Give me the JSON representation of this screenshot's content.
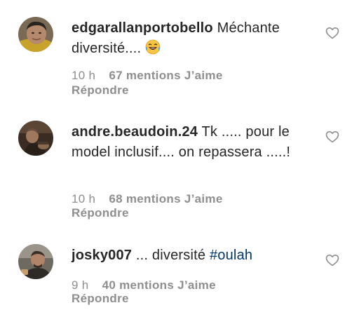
{
  "comments": [
    {
      "username": "edgarallanportobello",
      "text": "Méchante diversité....",
      "emoji": "laughing-crying-emoji",
      "time": "10 h",
      "likes": "67 mentions J’aime",
      "reply": "Répondre"
    },
    {
      "username": "andre.beaudoin.24",
      "text": "Tk ..... pour le model inclusif.... on repassera .....!",
      "time": "10 h",
      "likes": "68 mentions J’aime",
      "reply": "Répondre"
    },
    {
      "username": "josky007",
      "text": "... diversité ",
      "hashtag": "#oulah",
      "time": "9 h",
      "likes": "40 mentions J’aime",
      "reply": "Répondre"
    }
  ],
  "colors": {
    "text": "#262626",
    "secondary": "#8e8e8e",
    "hashtag": "#00376b",
    "background": "#ffffff"
  }
}
